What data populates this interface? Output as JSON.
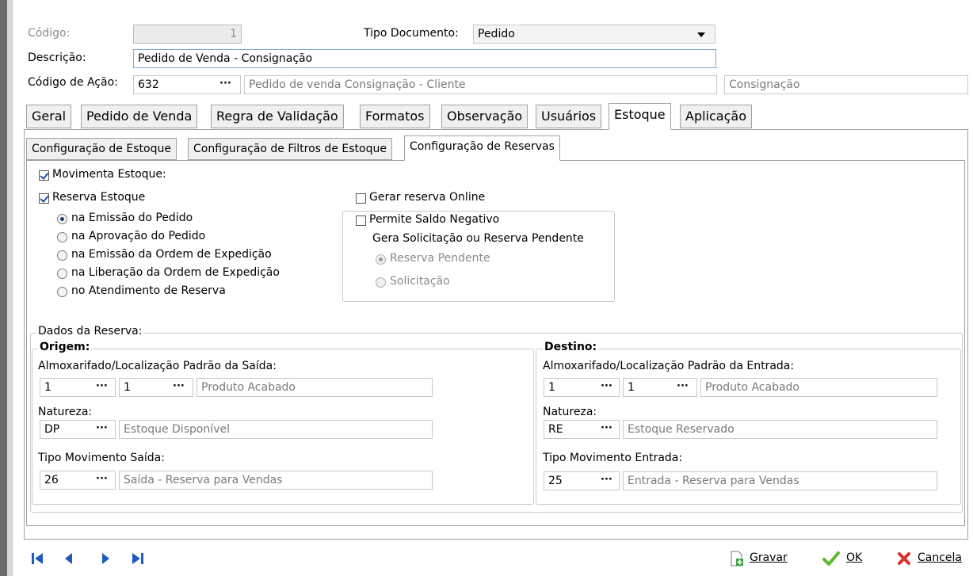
{
  "header": {
    "codigo_label": "Código:",
    "codigo_value": "1",
    "tipo_doc_label": "Tipo Documento:",
    "tipo_doc_value": "Pedido",
    "descricao_label": "Descrição:",
    "descricao_value": "Pedido de Venda - Consignação",
    "acao_label": "Código de Ação:",
    "acao_code": "632",
    "acao_desc": "Pedido de venda Consignação - Cliente",
    "acao_extra": "Consignação"
  },
  "tabs": [
    "Geral",
    "Pedido de Venda",
    "Regra de Validação",
    "Formatos",
    "Observação",
    "Usuários",
    "Estoque",
    "Aplicação"
  ],
  "subtabs": [
    "Configuração de Estoque",
    "Configuração de Filtros de Estoque",
    "Configuração de Reservas"
  ],
  "options": {
    "movimenta": "Movimenta Estoque:",
    "reserva": "Reserva Estoque",
    "radios": [
      "na Emissão do Pedido",
      "na Aprovação do Pedido",
      "na Emissão da Ordem de Expedição",
      "na Liberação da Ordem de Expedição",
      "no Atendimento de Reserva"
    ],
    "gerar_online": "Gerar reserva Online",
    "saldo_negativo": "Permite Saldo Negativo",
    "gera_solic": "Gera Solicitação ou Reserva Pendente",
    "reserva_pendente": "Reserva Pendente",
    "solicitacao": "Solicitação"
  },
  "dados": {
    "title": "Dados da Reserva:",
    "origem": {
      "title": "Origem:",
      "almox_label": "Almoxarifado/Localização Padrão da Saída:",
      "almox_a": "1",
      "almox_b": "1",
      "almox_desc": "Produto Acabado",
      "natureza_label": "Natureza:",
      "natureza_code": "DP",
      "natureza_desc": "Estoque Disponível",
      "tipo_label": "Tipo Movimento Saída:",
      "tipo_code": "26",
      "tipo_desc": "Saída - Reserva para Vendas"
    },
    "destino": {
      "title": "Destino:",
      "almox_label": "Almoxarifado/Localização Padrão da Entrada:",
      "almox_a": "1",
      "almox_b": "1",
      "almox_desc": "Produto Acabado",
      "natureza_label": "Natureza:",
      "natureza_code": "RE",
      "natureza_desc": "Estoque Reservado",
      "tipo_label": "Tipo Movimento Entrada:",
      "tipo_code": "25",
      "tipo_desc": "Entrada - Reserva para Vendas"
    }
  },
  "footer": {
    "gravar": "Gravar",
    "ok": "OK",
    "cancela": "Cancela"
  },
  "ellipsis": "···"
}
